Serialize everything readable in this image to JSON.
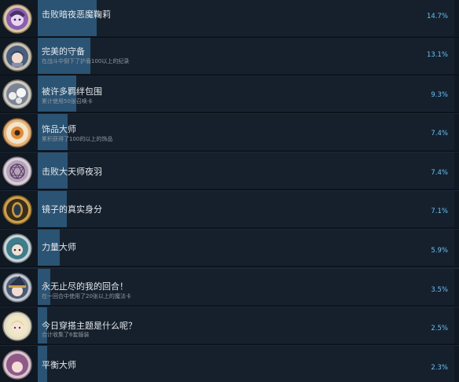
{
  "colors": {
    "background": "#1b2838",
    "row_background": "#16202d",
    "bar_fill": "#2b5373",
    "title_text": "#e4e8ec",
    "description_text": "#8f98a0",
    "percent_text": "#66c0f4"
  },
  "achievements": [
    {
      "title": "击败暗夜恶魔鞠莉",
      "description": "",
      "percent": "14.7%",
      "fill": 0.147,
      "icon": "purple-demon-girl-achievement-icon"
    },
    {
      "title": "完美的守备",
      "description": "在战斗中倒下了护盾100以上的纪录",
      "percent": "13.1%",
      "fill": 0.131,
      "icon": "blue-haired-warrior-achievement-icon"
    },
    {
      "title": "被许多羁绊包围",
      "description": "累计使用50张召唤卡",
      "percent": "9.3%",
      "fill": 0.093,
      "icon": "white-creature-group-achievement-icon"
    },
    {
      "title": "饰品大师",
      "description": "累积获得了100的以上的饰品",
      "percent": "7.4%",
      "fill": 0.074,
      "icon": "orange-accessory-achievement-icon"
    },
    {
      "title": "击败大天师夜羽",
      "description": "",
      "percent": "7.4%",
      "fill": 0.074,
      "icon": "magic-circle-achievement-icon"
    },
    {
      "title": "镜子的真实身分",
      "description": "",
      "percent": "7.1%",
      "fill": 0.071,
      "icon": "golden-mirror-achievement-icon"
    },
    {
      "title": "力量大师",
      "description": "",
      "percent": "5.9%",
      "fill": 0.059,
      "icon": "teal-haired-girl-achievement-icon"
    },
    {
      "title": "永无止尽的我的回合！",
      "description": "在一回合中使用了20张以上的魔法卡",
      "percent": "3.5%",
      "fill": 0.035,
      "icon": "witch-hat-girl-achievement-icon"
    },
    {
      "title": "今日穿搭主题是什么呢？",
      "description": "合计收集了6套服装",
      "percent": "2.5%",
      "fill": 0.025,
      "icon": "blonde-girl-achievement-icon"
    },
    {
      "title": "平衡大师",
      "description": "",
      "percent": "2.3%",
      "fill": 0.023,
      "icon": "pink-haired-girl-achievement-icon"
    }
  ]
}
